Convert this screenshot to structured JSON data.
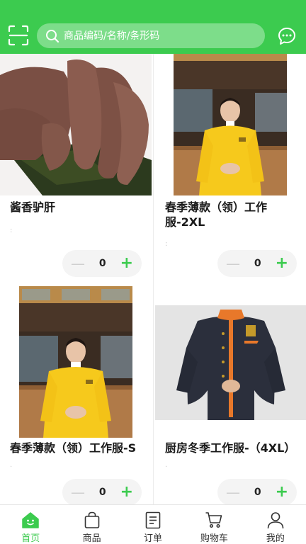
{
  "header": {
    "search_placeholder": "商品编码/名称/条形码",
    "scan_icon": "scan-icon",
    "chat_icon": "chat-icon"
  },
  "colors": {
    "accent": "#3ccb4f",
    "search_bg": "#7ddd8a",
    "text": "#1a1a1a"
  },
  "products": [
    {
      "name": "酱香驴肝",
      "note": ":",
      "qty": "0",
      "minus": "—",
      "plus": "+"
    },
    {
      "name": "春季薄款（领）工作服-2XL",
      "note": ":",
      "qty": "0",
      "minus": "—",
      "plus": "+"
    },
    {
      "name": "春季薄款（领）工作服-S",
      "note": "·",
      "qty": "0",
      "minus": "—",
      "plus": "+"
    },
    {
      "name": "厨房冬季工作服-（4XL）",
      "note": "·",
      "qty": "0",
      "minus": "—",
      "plus": "+"
    }
  ],
  "nav": [
    {
      "label": "首页",
      "icon": "home-icon",
      "active": true
    },
    {
      "label": "商品",
      "icon": "bag-icon",
      "active": false
    },
    {
      "label": "订单",
      "icon": "order-icon",
      "active": false
    },
    {
      "label": "购物车",
      "icon": "cart-icon",
      "active": false
    },
    {
      "label": "我的",
      "icon": "profile-icon",
      "active": false
    }
  ]
}
